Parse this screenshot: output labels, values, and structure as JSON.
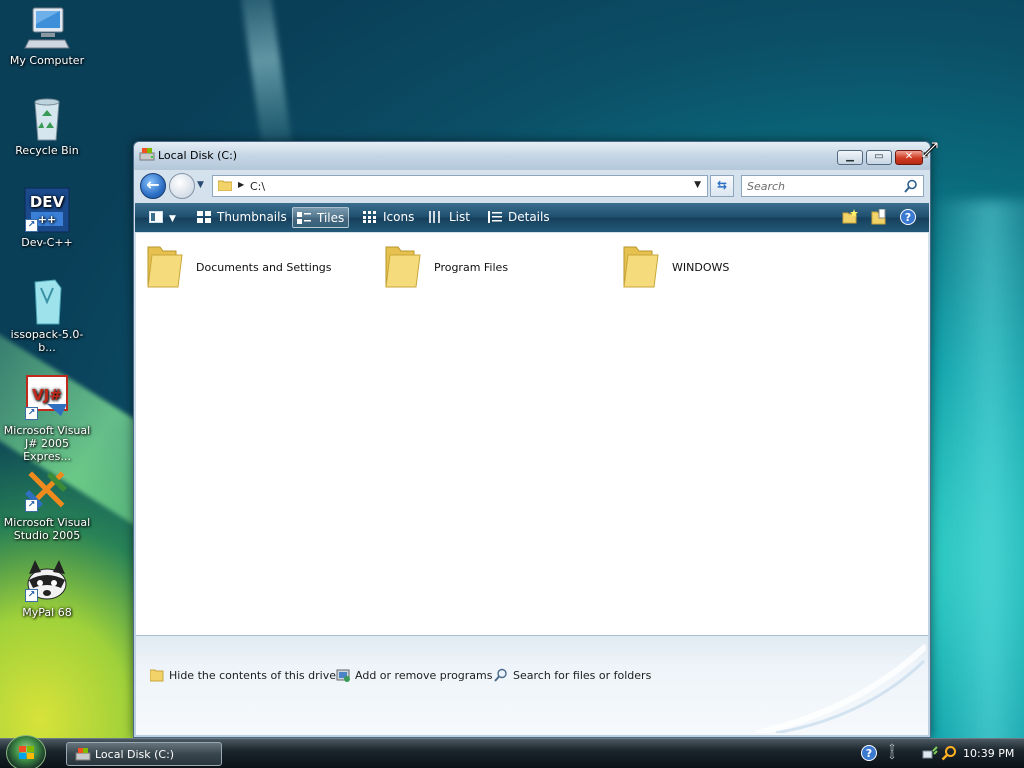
{
  "desktop": {
    "icons": [
      {
        "label": "My Computer",
        "icon": "computer-icon"
      },
      {
        "label": "Recycle Bin",
        "icon": "recycle-bin-icon"
      },
      {
        "label": "Dev-C++",
        "icon": "dev-cpp-icon",
        "shortcut": true,
        "badge": "DEV"
      },
      {
        "label": "issopack-5.0-b...",
        "icon": "file-icon"
      },
      {
        "label": "Microsoft Visual J# 2005 Expres...",
        "icon": "visual-jsharp-icon",
        "shortcut": true,
        "badge": "VJ#"
      },
      {
        "label": "Microsoft Visual Studio 2005",
        "icon": "visual-studio-icon",
        "shortcut": true
      },
      {
        "label": "MyPal 68",
        "icon": "mypal-raccoon-icon",
        "shortcut": true
      }
    ]
  },
  "window": {
    "title": "Local Disk (C:)",
    "address": "C:\\",
    "search_placeholder": "Search",
    "toolbar": {
      "thumbnails": "Thumbnails",
      "tiles": "Tiles",
      "icons": "Icons",
      "list": "List",
      "details": "Details",
      "active_view": "Tiles"
    },
    "items": [
      {
        "name": "Documents and Settings",
        "type": "folder"
      },
      {
        "name": "Program Files",
        "type": "folder"
      },
      {
        "name": "WINDOWS",
        "type": "folder"
      }
    ],
    "tasks": [
      {
        "label": "Hide the contents of this drive",
        "icon": "folder-icon"
      },
      {
        "label": "Add or remove programs",
        "icon": "programs-icon"
      },
      {
        "label": "Search for files or folders",
        "icon": "search-icon"
      }
    ]
  },
  "taskbar": {
    "buttons": [
      {
        "label": "Local Disk (C:)"
      }
    ],
    "clock": "10:39 PM"
  },
  "colors": {
    "command_bar": "#1f4f6e",
    "close_button": "#cf3b22",
    "folder": "#f2d36a"
  }
}
